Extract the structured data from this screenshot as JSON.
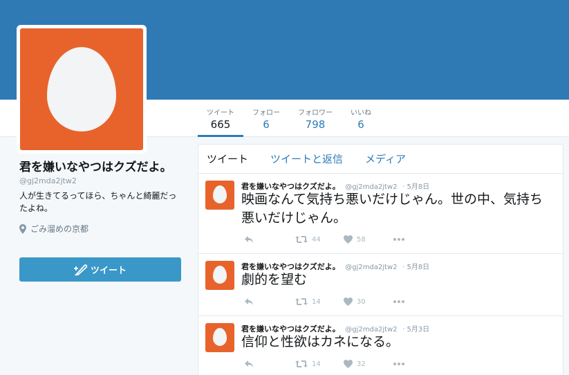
{
  "profile": {
    "name": "君を嫌いなやつはクズだよ。",
    "handle": "@gj2mda2jtw2",
    "bio": "人が生きてるってほら、ちゃんと綺麗だったよね。",
    "location": "ごみ溜めの京都"
  },
  "stats": [
    {
      "label": "ツイート",
      "value": "665"
    },
    {
      "label": "フォロー",
      "value": "6"
    },
    {
      "label": "フォロワー",
      "value": "798"
    },
    {
      "label": "いいね",
      "value": "6"
    }
  ],
  "compose": {
    "label": "ツイート"
  },
  "tabs": [
    "ツイート",
    "ツイートと返信",
    "メディア"
  ],
  "tweets": [
    {
      "name": "君を嫌いなやつはクズだよ。",
      "handle": "@gj2mda2jtw2",
      "date": "· 5月8日",
      "text": "映画なんて気持ち悪いだけじゃん。世の中、気持ち悪いだけじゃん。",
      "retweets": "44",
      "likes": "58"
    },
    {
      "name": "君を嫌いなやつはクズだよ。",
      "handle": "@gj2mda2jtw2",
      "date": "· 5月8日",
      "text": "劇的を望む",
      "retweets": "14",
      "likes": "30"
    },
    {
      "name": "君を嫌いなやつはクズだよ。",
      "handle": "@gj2mda2jtw2",
      "date": "· 5月3日",
      "text": "信仰と性欲はカネになる。",
      "retweets": "14",
      "likes": "32"
    }
  ],
  "colors": {
    "banner": "#2f7ab5",
    "accent": "#2b7bb9",
    "avatar": "#e8632b",
    "button": "#3a98c8"
  },
  "icons": {
    "reply": "reply-icon",
    "retweet": "retweet-icon",
    "like": "heart-icon",
    "more": "more-icon",
    "location": "location-pin-icon",
    "compose": "quill-icon"
  }
}
